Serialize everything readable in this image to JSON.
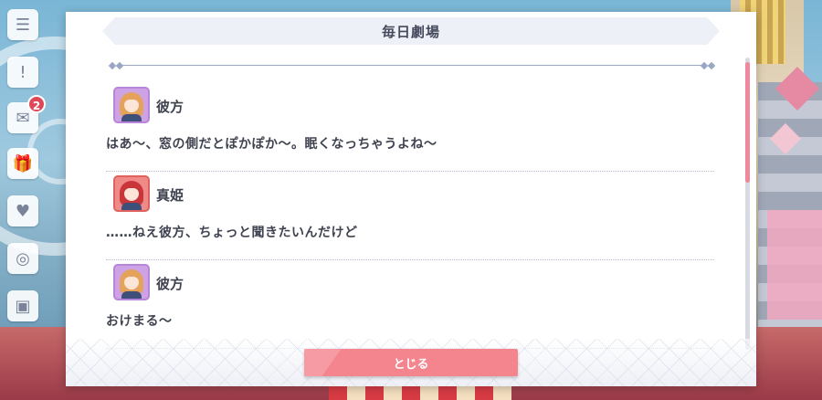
{
  "dialog": {
    "title": "毎日劇場",
    "close_label": "とじる"
  },
  "entries": [
    {
      "speaker": "彼方",
      "avatar": "kanata-avatar",
      "text": "はあ〜、窓の側だとぽかぽか〜。眠くなっちゃうよね〜"
    },
    {
      "speaker": "真姫",
      "avatar": "maki-avatar",
      "text": "……ねえ彼方、ちょっと聞きたいんだけど"
    },
    {
      "speaker": "彼方",
      "avatar": "kanata-avatar",
      "text": "おけまる〜"
    }
  ],
  "side_menu": {
    "badge_count": "2",
    "icons": [
      "menu-icon",
      "notice-icon",
      "present-icon",
      "gift-icon",
      "card-icon",
      "shop-icon",
      "camera-icon"
    ]
  },
  "colors": {
    "accent": "#f4858f",
    "scroll_thumb": "#f0879f",
    "badge": "#e0485a"
  }
}
